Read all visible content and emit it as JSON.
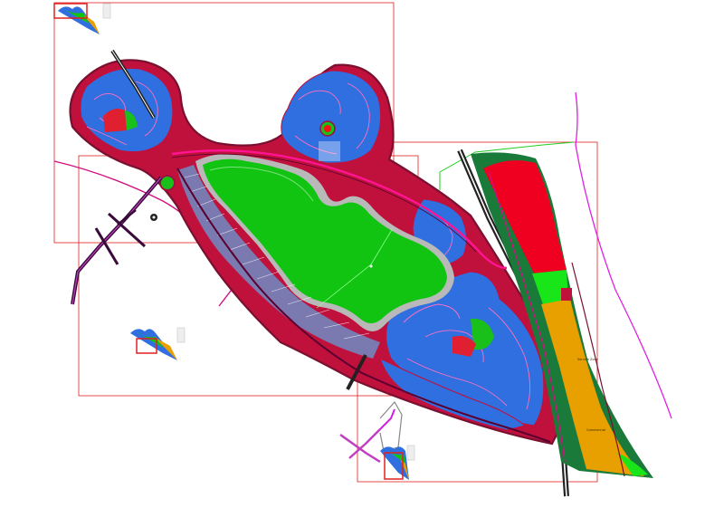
{
  "drawing": {
    "background": "#ffffff",
    "colors": {
      "frame": "#e02020",
      "boundary": "#7a1030",
      "residential_fill": "#2f6fe0",
      "road": "#c0103c",
      "road_magenta": "#d01080",
      "lake_fill": "#11c411",
      "lake_edge": "#b9b9b9",
      "lake_highlight": "#7ae07a",
      "open_space": "#19e619",
      "commercial": "#f00020",
      "orange_zone": "#e8a000",
      "highway": "#222222",
      "parking": "#7a7ab0",
      "purple_path": "#d020e0",
      "green_line": "#22cc22",
      "neon_road": "#ff1493",
      "grey_trail": "#888888"
    },
    "labels": {
      "zone_a": "Service Zone",
      "zone_b": "Commercial"
    },
    "key_plan_icons": [
      "key-plan-top-left",
      "key-plan-center",
      "key-plan-bottom"
    ],
    "north_arrow": "north-arrow-icon"
  }
}
